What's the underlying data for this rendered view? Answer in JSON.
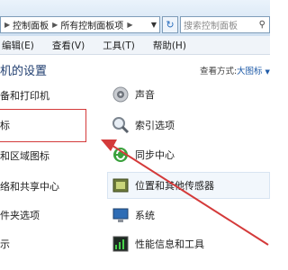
{
  "address": {
    "segments": [
      "控制面板",
      "所有控制面板项"
    ],
    "search_placeholder": "搜索控制面板"
  },
  "menu": [
    "编辑(E)",
    "查看(V)",
    "工具(T)",
    "帮助(H)"
  ],
  "header": {
    "title": "机的设置",
    "view_label": "查看方式:",
    "view_value": "大图标"
  },
  "items_left": [
    {
      "label": "备和打印机"
    },
    {
      "label": "标"
    },
    {
      "label": "和区域图标"
    },
    {
      "label": "络和共享中心"
    },
    {
      "label": "件夹选项"
    },
    {
      "label": "示"
    }
  ],
  "items_right": [
    {
      "label": "声音"
    },
    {
      "label": "索引选项"
    },
    {
      "label": "同步中心"
    },
    {
      "label": "位置和其他传感器"
    },
    {
      "label": "系统"
    },
    {
      "label": "性能信息和工具"
    }
  ],
  "colors": {
    "annotation": "#d43a3a",
    "title": "#1f3d6f"
  }
}
